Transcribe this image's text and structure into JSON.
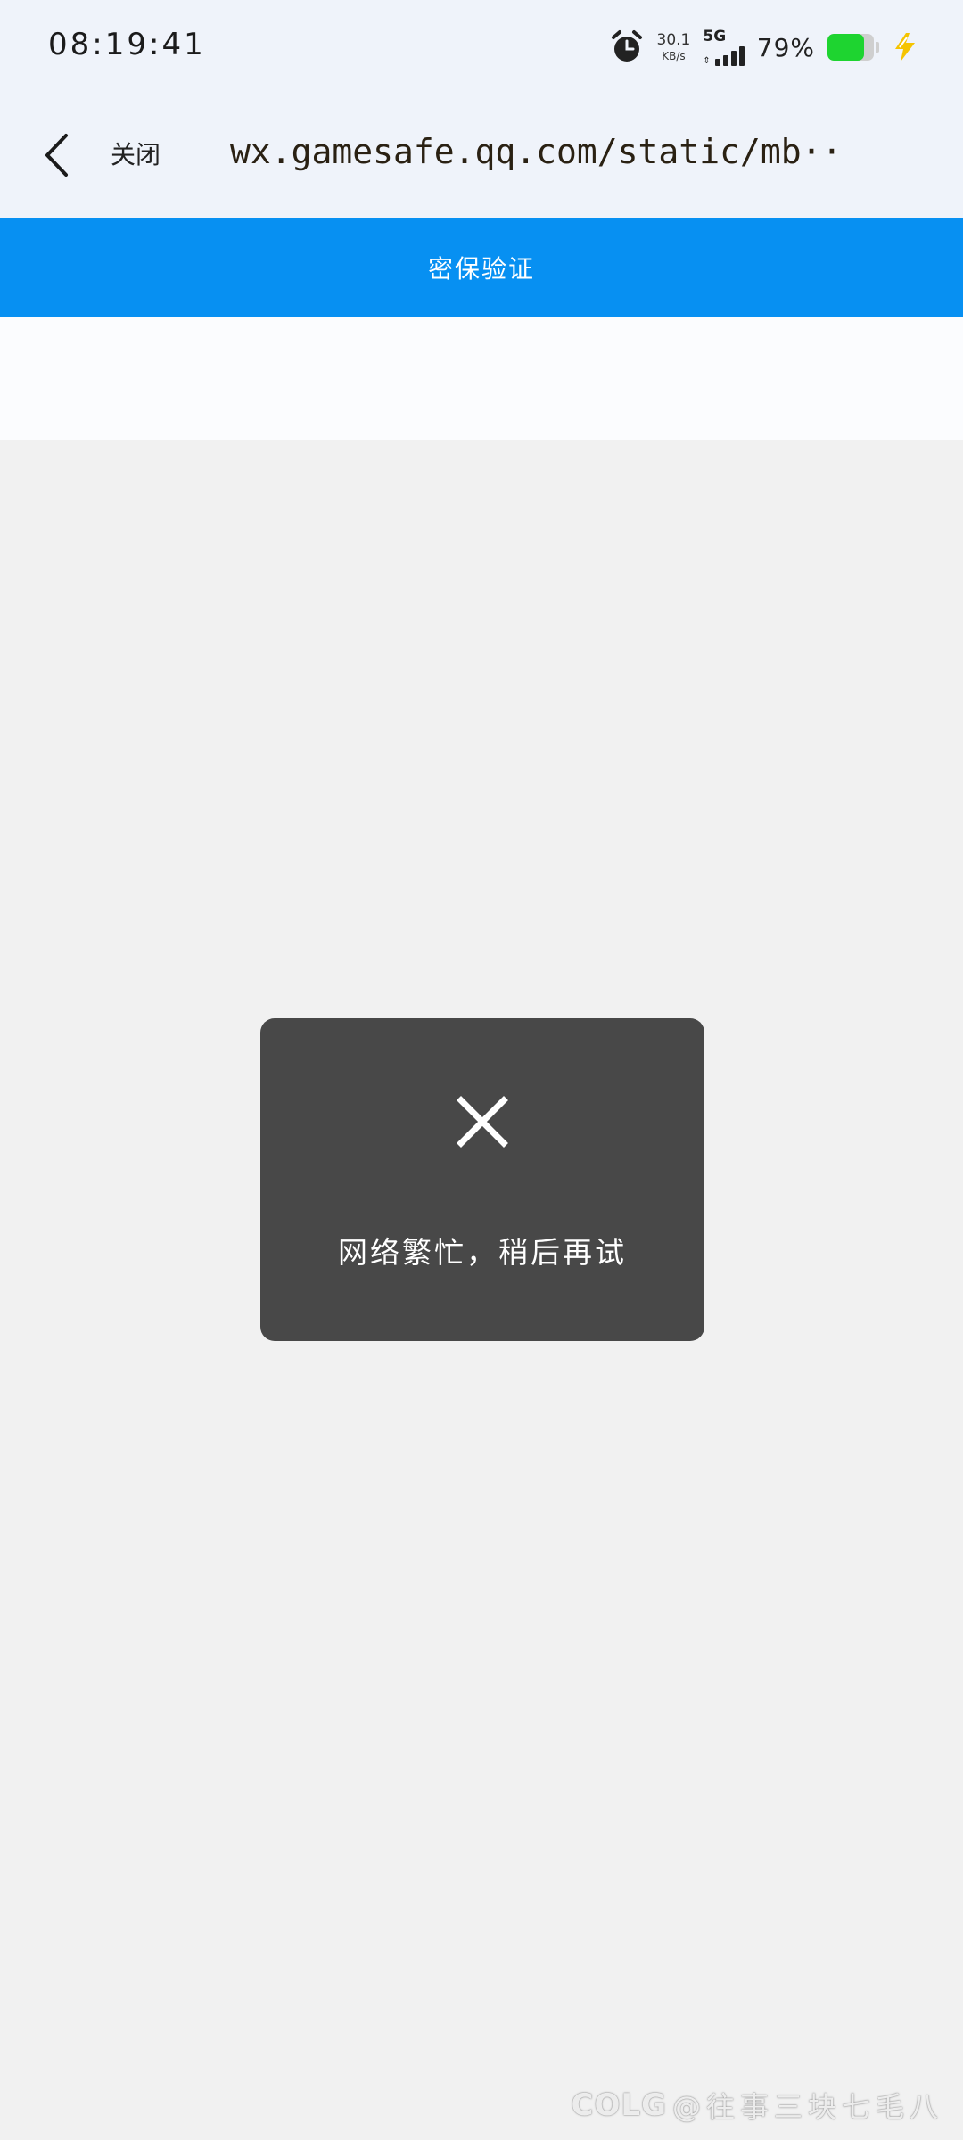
{
  "status_bar": {
    "time": "08:19:41",
    "net_speed_value": "30.1",
    "net_speed_unit": "KB/s",
    "network_type": "5G",
    "battery_percent": "79%",
    "battery_level": 0.79,
    "battery_color": "#1ed430",
    "icons": [
      "alarm-icon",
      "signal-icon",
      "battery-icon",
      "charging-bolt-icon"
    ]
  },
  "toolbar": {
    "back_icon": "chevron-left-icon",
    "close_label": "关闭",
    "url": "wx.gamesafe.qq.com/static/mb··"
  },
  "page": {
    "title": "密保验证",
    "header_color": "#0790f2"
  },
  "toast": {
    "icon": "close-icon",
    "message": "网络繁忙，稍后再试"
  },
  "watermark": {
    "logo": "COLG",
    "handle": "@往事三块七毛八"
  }
}
